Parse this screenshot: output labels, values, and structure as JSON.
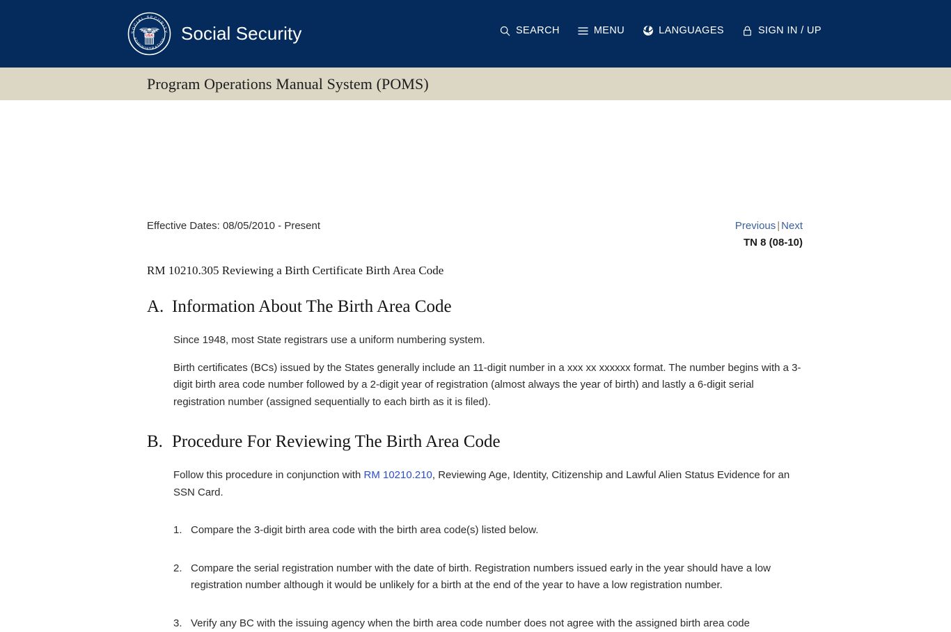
{
  "header": {
    "brand_name": "Social Security",
    "logo_alt": "ssa-seal",
    "seal_text_top": "SOCIAL SECURITY",
    "seal_text_bottom": "ADMINISTRATION",
    "seal_badge": "USA",
    "nav": [
      {
        "label": "SEARCH",
        "icon": "search-icon"
      },
      {
        "label": "MENU",
        "icon": "hamburger-menu-icon"
      },
      {
        "label": "LANGUAGES",
        "icon": "globe-icon"
      },
      {
        "label": "SIGN IN / UP",
        "icon": "lock-icon"
      }
    ],
    "colors": {
      "navy": "#042b5c",
      "tan": "#dcd7c5",
      "link_blue": "#2b4fc8",
      "pager_blue": "#3a5fa0"
    }
  },
  "poms_bar": {
    "title": "Program Operations Manual System (POMS)"
  },
  "meta": {
    "effective_dates": "Effective Dates: 08/05/2010 - Present",
    "previous_label": "Previous",
    "separator": "|",
    "next_label": "Next",
    "tn": "TN 8 (08-10)"
  },
  "document": {
    "rm_heading": "RM 10210.305 Reviewing a Birth Certificate Birth Area Code",
    "sections": [
      {
        "letter": "A.",
        "title": "Information About The Birth Area Code",
        "paragraphs": [
          "Since 1948, most State registrars use a uniform numbering system.",
          "Birth certificates (BCs) issued by the States generally include an 11-digit number in a xxx xx xxxxxx format. The number begins with a 3-digit birth area code number followed by a 2-digit year of registration (almost always the year of birth) and lastly a 6-digit serial registration number (assigned sequentially to each birth as it is filed)."
        ]
      },
      {
        "letter": "B.",
        "title": "Procedure For Reviewing The Birth Area Code",
        "intro_before_link": "Follow this procedure in conjunction with ",
        "intro_link": "RM 10210.210",
        "intro_after_link": ", Reviewing Age, Identity, Citizenship and Lawful Alien Status Evidence for an SSN Card.",
        "items": [
          {
            "num": "1.",
            "text": "Compare the 3-digit birth area code with the birth area code(s) listed below."
          },
          {
            "num": "2.",
            "text": "Compare the serial registration number with the date of birth. Registration numbers issued early in the year should have a low registration number although it would be unlikely for a birth at the end of the year to have a low registration number."
          },
          {
            "num": "3.",
            "text": "Verify any BC with the issuing agency when the birth area code number does not agree with the assigned birth area code"
          }
        ]
      }
    ]
  }
}
